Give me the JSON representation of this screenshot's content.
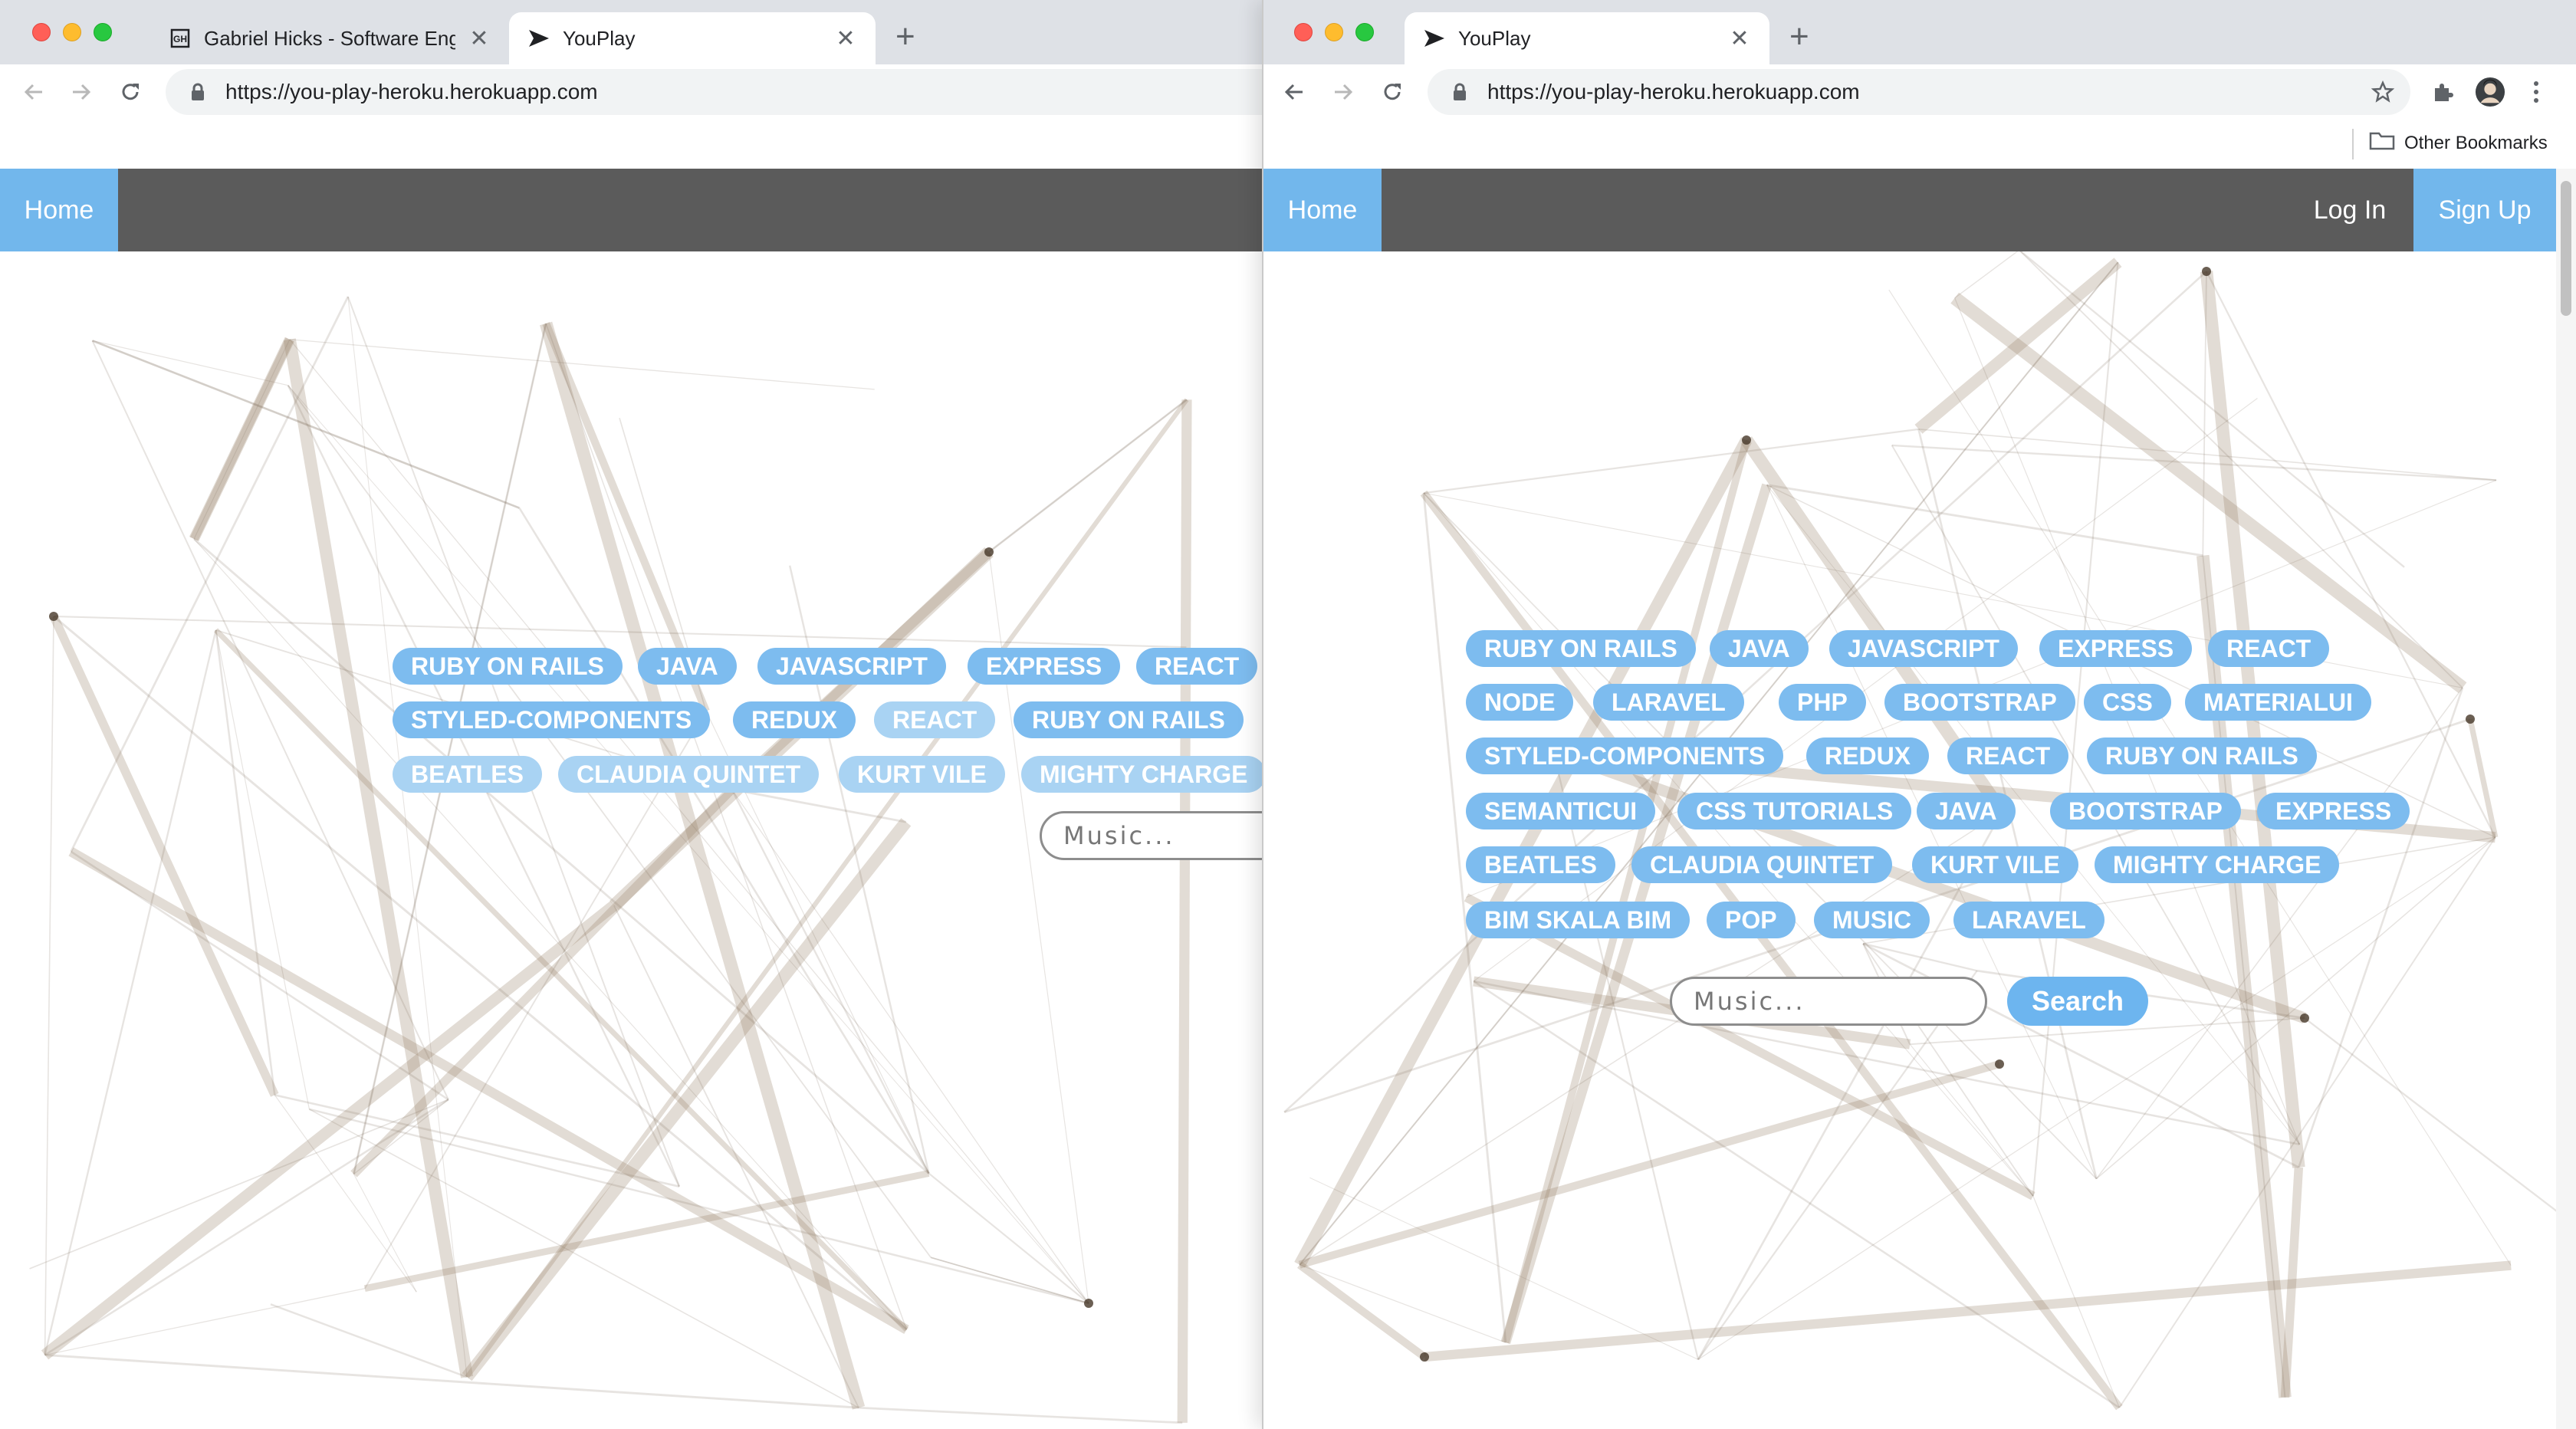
{
  "colors": {
    "accent": "#72b7ec",
    "navbar": "#5b5b5b",
    "chip": "#7dbcef",
    "chip_faded": "#a9d3f3"
  },
  "left_window": {
    "tabs": [
      {
        "title": "Gabriel Hicks - Software Engin",
        "favicon": "gh-logo-icon",
        "active": false
      },
      {
        "title": "YouPlay",
        "favicon": "youplay-logo-icon",
        "active": true
      }
    ],
    "url": "https://you-play-heroku.herokuapp.com",
    "nav": {
      "home": "Home"
    },
    "chips": {
      "row1": [
        "RUBY ON RAILS",
        "JAVA",
        "JAVASCRIPT",
        "EXPRESS",
        "REACT"
      ],
      "row2": [
        "STYLED-COMPONENTS",
        "REDUX",
        "REACT",
        "RUBY ON RAILS"
      ],
      "row3": [
        "BEATLES",
        "CLAUDIA QUINTET",
        "KURT VILE",
        "MIGHTY CHARGE"
      ]
    },
    "search_placeholder": "Music..."
  },
  "right_window": {
    "tabs": [
      {
        "title": "YouPlay",
        "favicon": "youplay-logo-icon",
        "active": true
      }
    ],
    "url": "https://you-play-heroku.herokuapp.com",
    "bookmarks": {
      "other": "Other Bookmarks"
    },
    "nav": {
      "home": "Home",
      "login": "Log In",
      "signup": "Sign Up"
    },
    "chips": {
      "row1": [
        "RUBY ON RAILS",
        "JAVA",
        "JAVASCRIPT",
        "EXPRESS",
        "REACT"
      ],
      "row2": [
        "NODE",
        "LARAVEL",
        "PHP",
        "BOOTSTRAP",
        "CSS",
        "MATERIALUI"
      ],
      "row3": [
        "STYLED-COMPONENTS",
        "REDUX",
        "REACT",
        "RUBY ON RAILS"
      ],
      "row4": [
        "SEMANTICUI",
        "CSS TUTORIALS",
        "JAVA",
        "BOOTSTRAP",
        "EXPRESS"
      ],
      "row5": [
        "BEATLES",
        "CLAUDIA QUINTET",
        "KURT VILE",
        "MIGHTY CHARGE"
      ],
      "row6": [
        "BIM SKALA BIM",
        "POP",
        "MUSIC",
        "LARAVEL"
      ]
    },
    "search_placeholder": "Music...",
    "search_button": "Search"
  }
}
